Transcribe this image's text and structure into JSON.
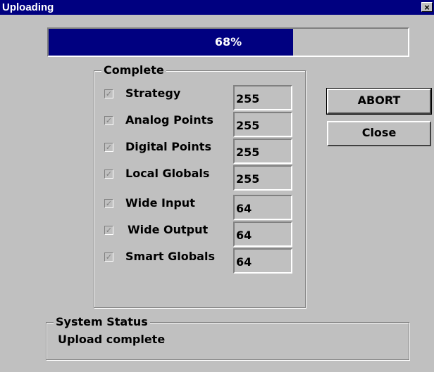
{
  "window": {
    "title": "Uploading",
    "close_glyph": "×"
  },
  "progress": {
    "percent": 68,
    "label": "68%",
    "fill_color": "#000080"
  },
  "complete_group": {
    "legend": "Complete",
    "items": [
      {
        "label": "Strategy",
        "value": "255",
        "checked": true
      },
      {
        "label": "Analog Points",
        "value": "255",
        "checked": true
      },
      {
        "label": "Digital Points",
        "value": "255",
        "checked": true
      },
      {
        "label": "Local Globals",
        "value": "255",
        "checked": true
      },
      {
        "label": "Wide Input",
        "value": "64",
        "checked": true
      },
      {
        "label": "Wide Output",
        "value": "64",
        "checked": true
      },
      {
        "label": "Smart Globals",
        "value": "64",
        "checked": true
      }
    ]
  },
  "buttons": {
    "abort": "ABORT",
    "close": "Close"
  },
  "system_status": {
    "legend": "System Status",
    "text": "Upload complete"
  }
}
